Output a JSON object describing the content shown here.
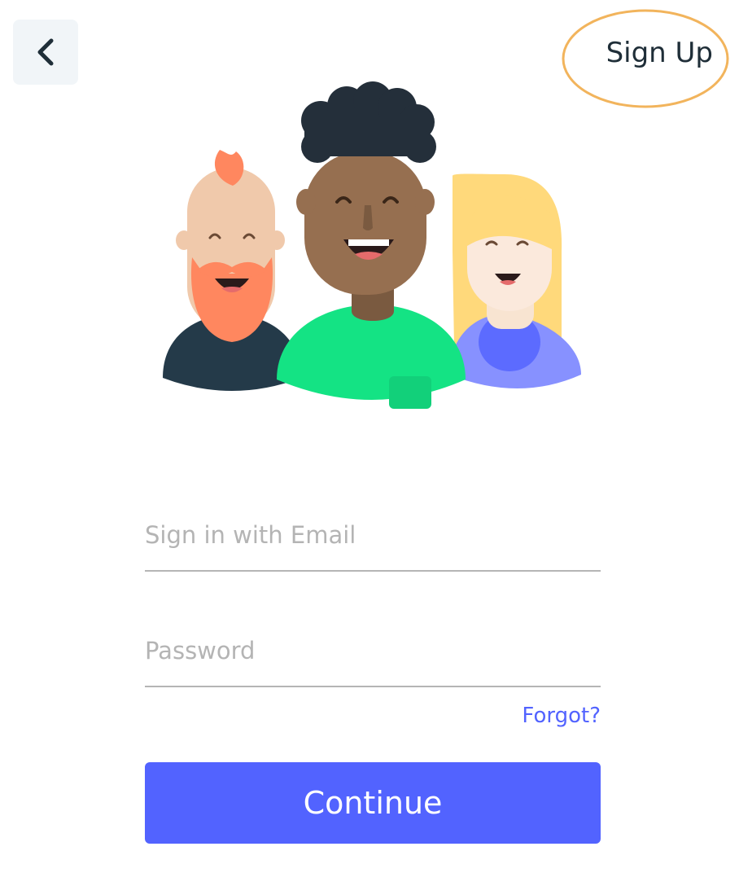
{
  "header": {
    "back_icon": "chevron-left-icon",
    "signup_label": "Sign Up"
  },
  "form": {
    "email_placeholder": "Sign in with Email",
    "email_value": "",
    "password_placeholder": "Password",
    "password_value": "",
    "forgot_label": "Forgot?",
    "continue_label": "Continue"
  },
  "colors": {
    "accent": "#5263ff",
    "highlight_ring": "#f2b45c",
    "back_button_bg": "#f1f5f8",
    "text_dark": "#1f2e38"
  }
}
